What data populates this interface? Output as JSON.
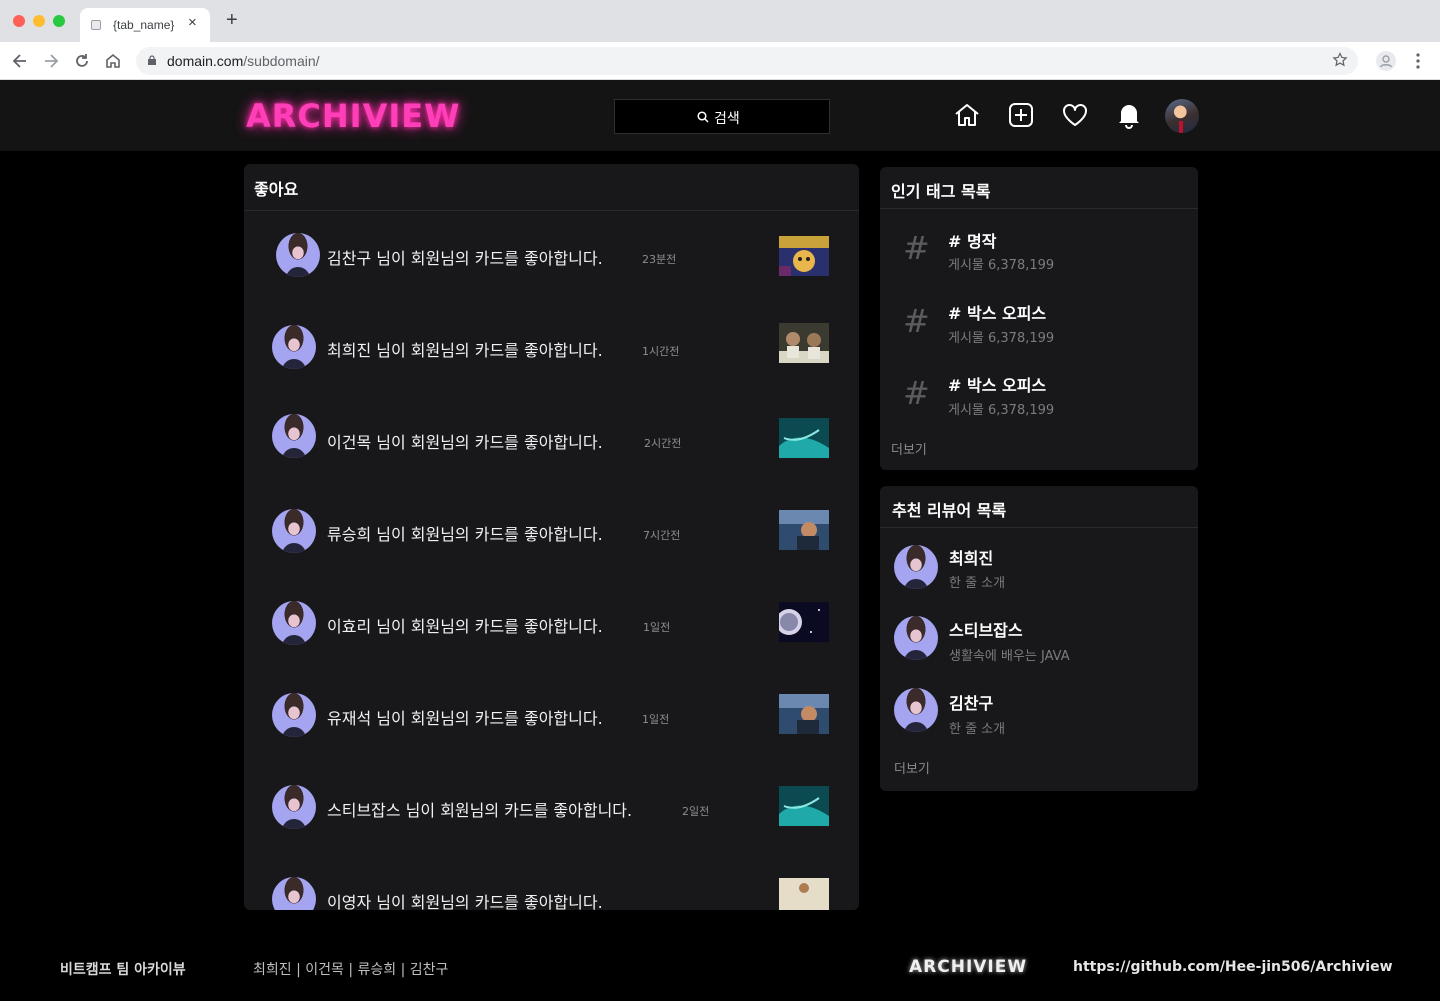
{
  "browser": {
    "tab_title": "{tab_name}",
    "tab_close": "×",
    "new_tab": "+",
    "url_domain": "domain.com",
    "url_path": "/subdomain/"
  },
  "header": {
    "logo": "ARCHIVIEW",
    "search_label": "검색"
  },
  "likes": {
    "title": "좋아요",
    "items": [
      {
        "text": "김찬구 님이 회원님의 카드를 좋아합니다.",
        "time": "23분전"
      },
      {
        "text": "최희진 님이 회원님의 카드를 좋아합니다.",
        "time": "1시간전"
      },
      {
        "text": "이건목 님이 회원님의 카드를 좋아합니다.",
        "time": "2시간전"
      },
      {
        "text": "류승희 님이 회원님의 카드를 좋아합니다.",
        "time": "7시간전"
      },
      {
        "text": "이효리 님이 회원님의 카드를 좋아합니다.",
        "time": "1일전"
      },
      {
        "text": "유재석 님이 회원님의 카드를 좋아합니다.",
        "time": "1일전"
      },
      {
        "text": "스티브잡스 님이 회원님의 카드를 좋아합니다.",
        "time": "2일전"
      },
      {
        "text": "이영자 님이 회원님의 카드를 좋아합니다.",
        "time": ""
      }
    ]
  },
  "popular_tags": {
    "title": "인기 태그 목록",
    "items": [
      {
        "hash": "#",
        "name": "# 명작",
        "count": "게시물 6,378,199"
      },
      {
        "hash": "#",
        "name": "# 박스 오피스",
        "count": "게시물 6,378,199"
      },
      {
        "hash": "#",
        "name": "# 박스 오피스",
        "count": "게시물 6,378,199"
      }
    ],
    "more": "더보기"
  },
  "reviewers": {
    "title": "추천 리뷰어 목록",
    "items": [
      {
        "name": "최희진",
        "bio": "한 줄 소개"
      },
      {
        "name": "스티브잡스",
        "bio": "생활속에 배우는 JAVA"
      },
      {
        "name": "김찬구",
        "bio": "한 줄 소개"
      }
    ],
    "more": "더보기"
  },
  "footer": {
    "team": "비트캠프 팀 아카이뷰",
    "members": "최희진 | 이건목 | 류승희 | 김찬구",
    "logo": "ARCHIVIEW",
    "link": "https://github.com/Hee-jin506/Archiview"
  },
  "colors": {
    "logo": "#ff3fb8",
    "panel": "#18181b",
    "header": "#141414",
    "background": "#000000"
  },
  "icons": [
    "home-icon",
    "add-icon",
    "heart-icon",
    "bell-icon",
    "search-icon",
    "hash-icon"
  ]
}
